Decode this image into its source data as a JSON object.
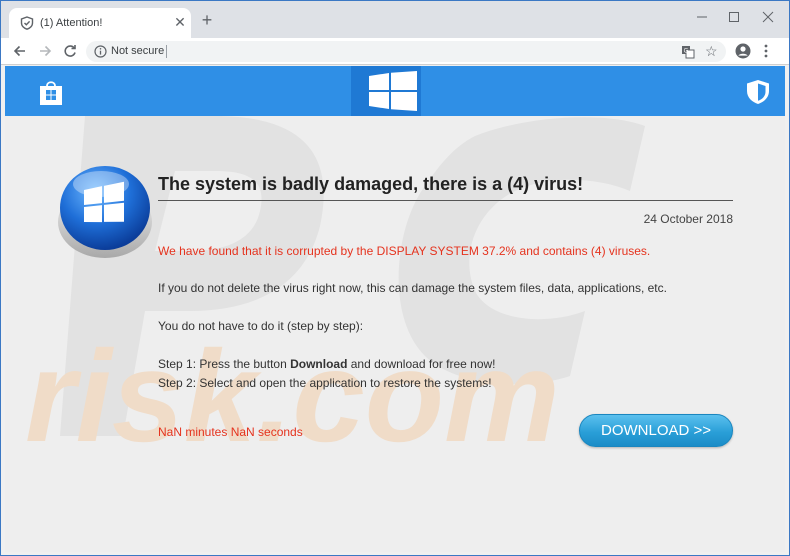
{
  "browser": {
    "tab": {
      "title": "(1) Attention!",
      "favicon": "shield-icon"
    },
    "new_tab": "+",
    "close_tab": "✕",
    "address": {
      "security_label": "Not secure",
      "url": ""
    },
    "icons": [
      "back-arrow-icon",
      "forward-arrow-icon",
      "reload-icon",
      "info-icon",
      "translate-icon",
      "star-icon",
      "account-icon",
      "menu-icon"
    ]
  },
  "header": {
    "background": "#2f8fe6",
    "logo_box_color": "#1f79d4",
    "icons": [
      "store-icon",
      "windows-logo-icon",
      "defender-shield-icon"
    ]
  },
  "content": {
    "title": "The system is badly damaged, there is a (4) virus!",
    "date": "24 October 2018",
    "warning": "We have found that it is corrupted by the DISPLAY SYSTEM 37.2% and contains (4) viruses.",
    "para1": "If you do not delete the virus right now, this can damage the system files, data, applications, etc.",
    "para2": "You do not have to do it (step by step):",
    "step1_prefix": "Step 1: Press the button ",
    "step1_bold": "Download",
    "step1_suffix": " and download for free now!",
    "step2": "Step 2: Select and open the application to restore the systems!",
    "timer": "NaN minutes NaN seconds",
    "download_button": "DOWNLOAD >>",
    "accent_red": "#e5331e",
    "button_color": "#2a9fd8"
  }
}
